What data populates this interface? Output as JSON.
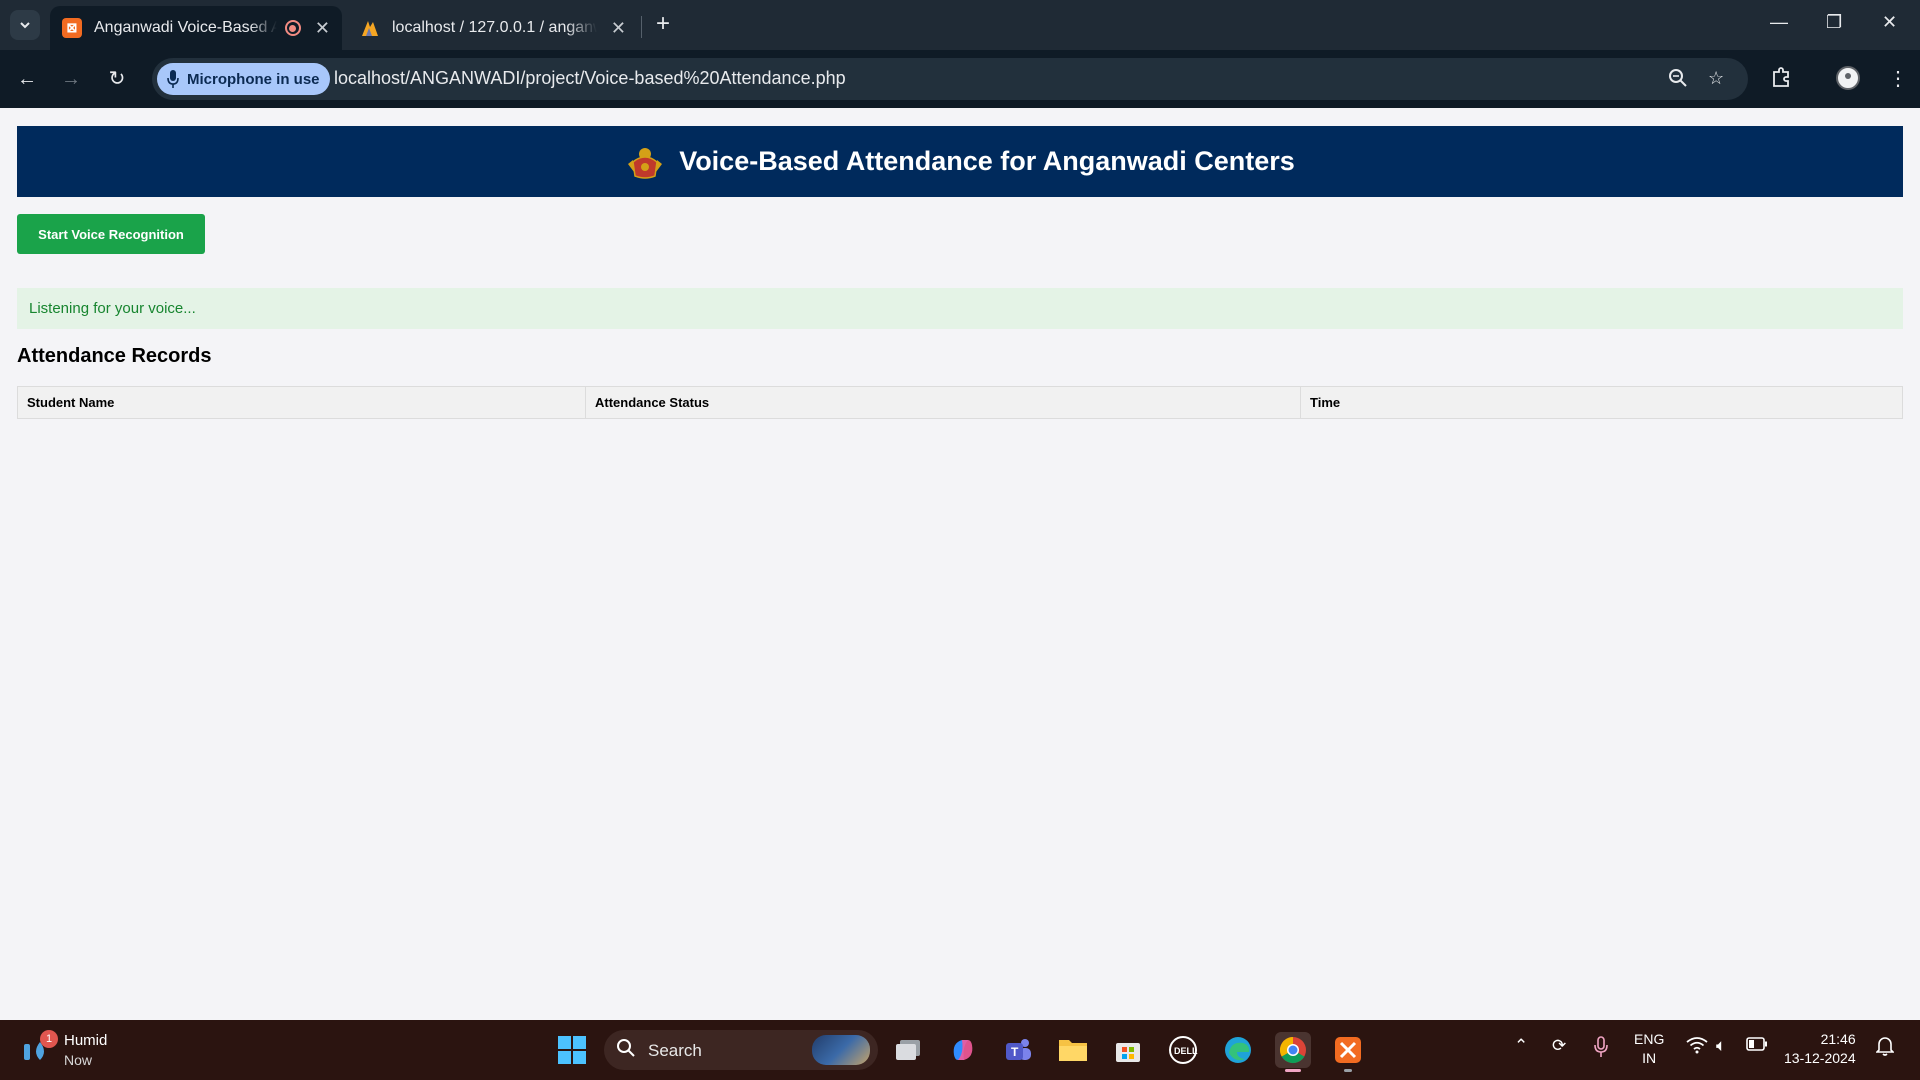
{
  "browser": {
    "tabs": [
      {
        "title": "Anganwadi Voice-Based Attendance",
        "active": true,
        "recording": true
      },
      {
        "title": "localhost / 127.0.0.1 / anganwadi",
        "active": false
      }
    ],
    "new_tab_label": "+",
    "mic_chip_label": "Microphone in use",
    "url": "localhost/ANGANWADI/project/Voice-based%20Attendance.php"
  },
  "page": {
    "banner_title": "Voice-Based Attendance for Anganwadi Centers",
    "start_button_label": "Start Voice Recognition",
    "status_text": "Listening for your voice...",
    "section_title": "Attendance Records",
    "table": {
      "columns": [
        "Student Name",
        "Attendance Status",
        "Time"
      ],
      "rows": []
    },
    "colors": {
      "banner_bg": "#002a5c",
      "button_bg": "#1aa34a",
      "status_bg": "#e4f3e6",
      "status_text": "#17852f"
    }
  },
  "taskbar": {
    "weather": {
      "title": "Humid",
      "subtitle": "Now",
      "badge": "1"
    },
    "search_placeholder": "Search",
    "apps": [
      "start-icon",
      "task-view-icon",
      "copilot-icon",
      "teams-icon",
      "file-explorer-icon",
      "store-icon",
      "dell-icon",
      "edge-icon",
      "chrome-icon",
      "xampp-icon"
    ],
    "language": {
      "line1": "ENG",
      "line2": "IN"
    },
    "clock": {
      "time": "21:46",
      "date": "13-12-2024"
    }
  }
}
